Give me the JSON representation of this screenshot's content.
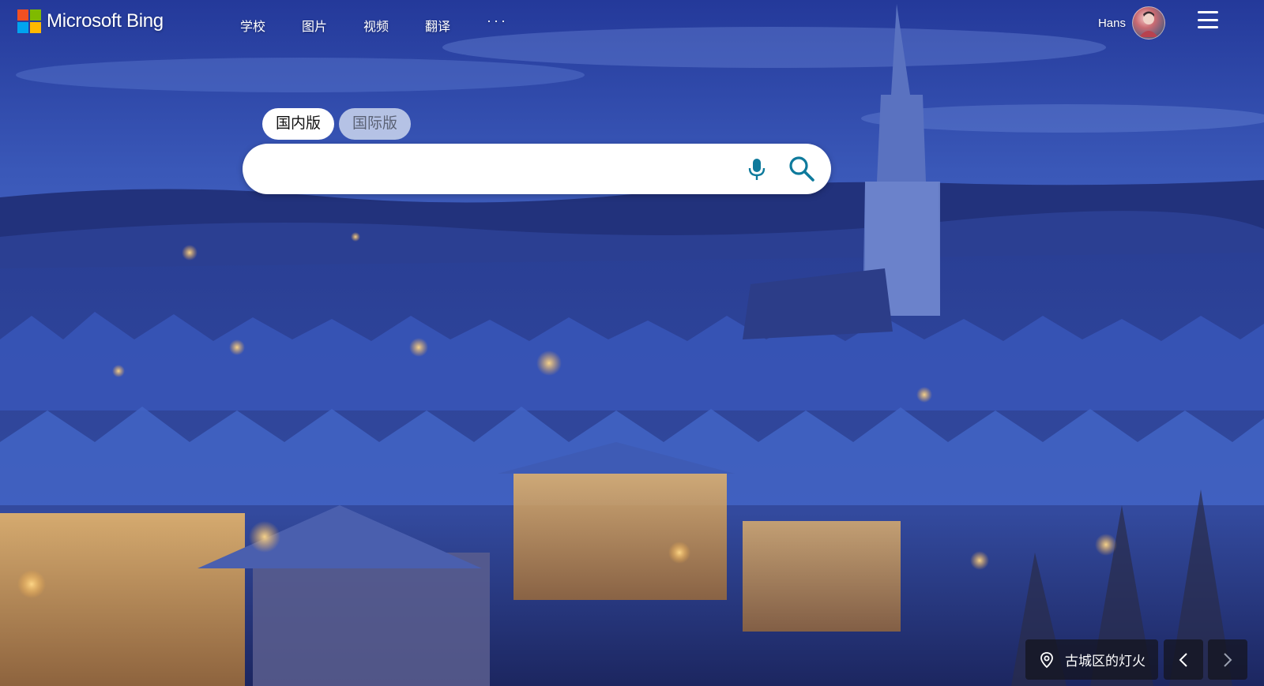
{
  "brand": {
    "name": "Microsoft Bing",
    "colors": {
      "red": "#f25022",
      "green": "#7fba00",
      "blue": "#00a4ef",
      "yellow": "#ffb900"
    }
  },
  "nav": {
    "items": [
      {
        "label": "学校"
      },
      {
        "label": "图片"
      },
      {
        "label": "视频"
      },
      {
        "label": "翻译"
      }
    ],
    "more_label": "···"
  },
  "user": {
    "name": "Hans"
  },
  "search": {
    "tabs": [
      {
        "label": "国内版",
        "active": true
      },
      {
        "label": "国际版",
        "active": false
      }
    ],
    "value": "",
    "placeholder": "",
    "mic_icon": "microphone-icon",
    "search_icon": "magnifier-icon",
    "icon_color": "#0e7a9c"
  },
  "image_of_day": {
    "caption": "古城区的灯火",
    "location_icon": "map-pin-icon",
    "prev_icon": "chevron-left-icon",
    "next_icon": "chevron-right-icon"
  }
}
